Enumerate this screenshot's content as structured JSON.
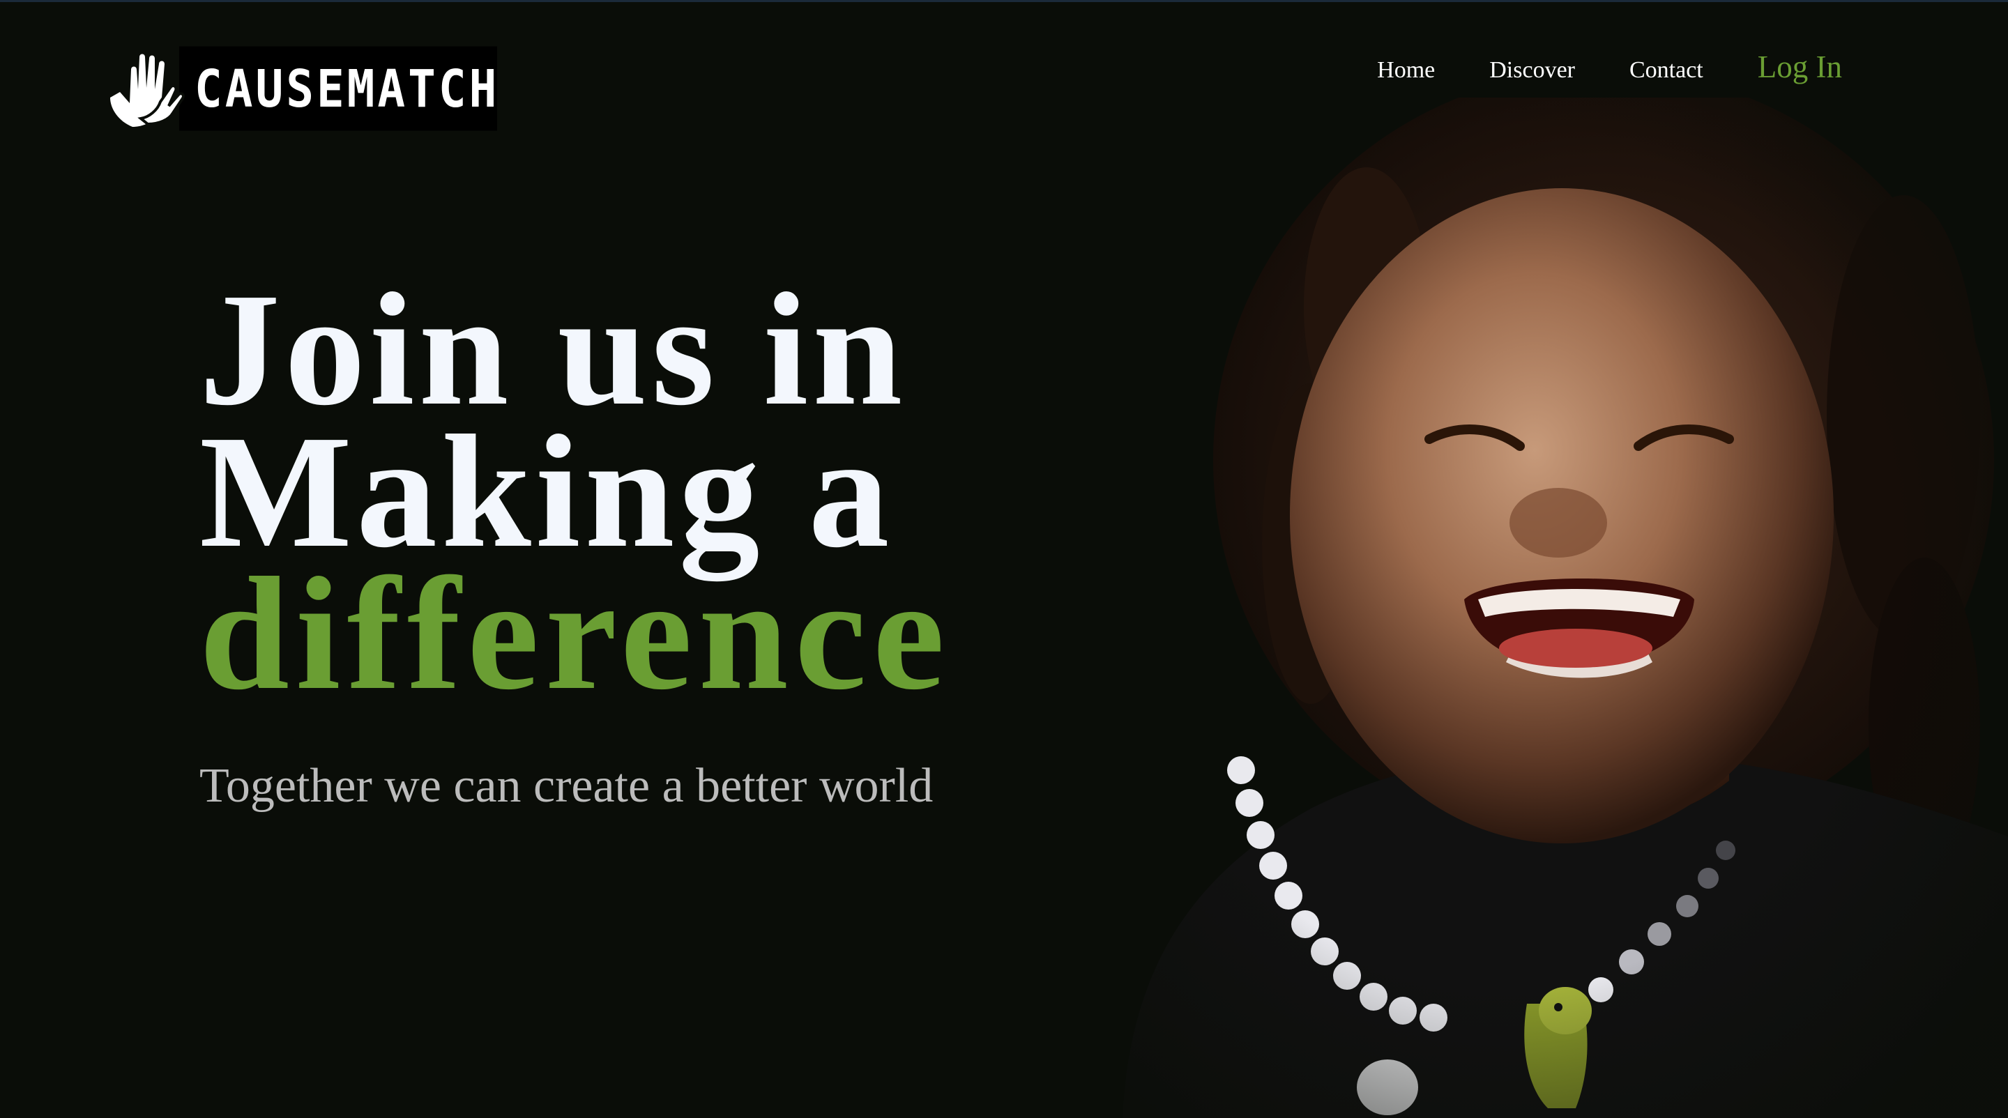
{
  "brand": {
    "name": "CAUSEMATCH",
    "logo_icon": "helping-hands-icon"
  },
  "nav": {
    "items": [
      {
        "label": "Home"
      },
      {
        "label": "Discover"
      },
      {
        "label": "Contact"
      }
    ],
    "login_label": "Log In"
  },
  "hero": {
    "line1": "Join us in",
    "line2": "Making a",
    "line3": "difference",
    "subtitle": "Together we can create a better world"
  },
  "image": {
    "subject": "laughing-child-photo"
  },
  "colors": {
    "background": "#0a0d08",
    "accent": "#6a9e33",
    "headline": "#f3f7fd",
    "subtitle": "#bcbcbc"
  }
}
